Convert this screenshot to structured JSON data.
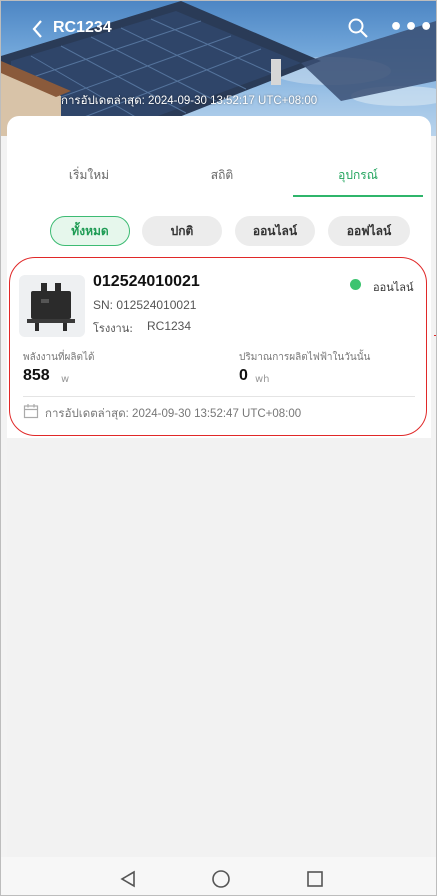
{
  "header": {
    "back_icon": "chevron-left-icon",
    "title": "RC1234",
    "last_update": "การอัปเดตล่าสุด: 2024-09-30 13:52:17 UTC+08:00"
  },
  "tabs": [
    {
      "label": "เริ่มใหม่",
      "active": false
    },
    {
      "label": "สถิติ",
      "active": false
    },
    {
      "label": "อุปกรณ์",
      "active": true
    }
  ],
  "filters": [
    {
      "label": "ทั้งหมด",
      "active": true
    },
    {
      "label": "ปกติ",
      "active": false
    },
    {
      "label": "ออนไลน์",
      "active": false
    },
    {
      "label": "ออฟไลน์",
      "active": false
    }
  ],
  "device": {
    "id": "012524010021",
    "sn": "SN: 012524010021",
    "plant_label": "โรงงาน:",
    "plant_value": "RC1234",
    "status": "ออนไลน์",
    "status_color": "#3cc46f",
    "power_label": "พลังงานที่ผลิตได้",
    "power_value": "858",
    "power_unit": "w",
    "energy_label": "ปริมาณการผลิตไฟฟ้าในวันนั้น",
    "energy_value": "0",
    "energy_unit": "wh",
    "last_update": "การอัปเดตล่าสุด: 2024-09-30 13:52:47 UTC+08:00"
  },
  "colors": {
    "accent": "#2fb56b",
    "highlight": "#e02828"
  }
}
